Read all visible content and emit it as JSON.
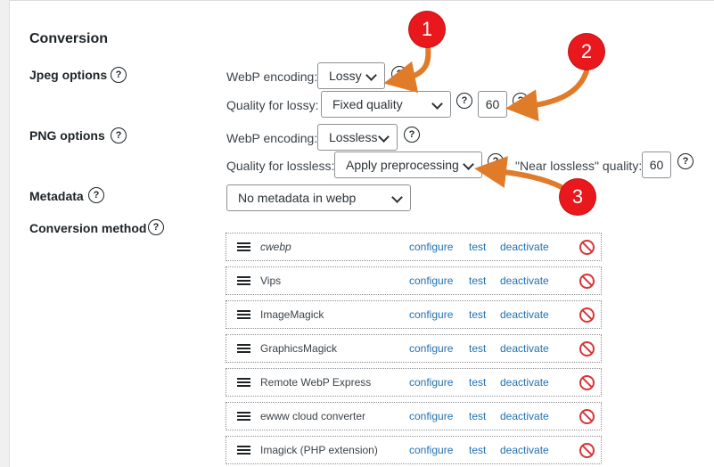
{
  "section_title": "Conversion",
  "jpeg": {
    "label": "Jpeg options",
    "encoding_label": "WebP encoding:",
    "encoding_value": "Lossy",
    "quality_label": "Quality for lossy:",
    "quality_value": "Fixed quality",
    "quality_number": "60"
  },
  "png": {
    "label": "PNG options",
    "encoding_label": "WebP encoding:",
    "encoding_value": "Lossless",
    "quality_label": "Quality for lossless:",
    "quality_value": "Apply preprocessing",
    "near_lossless_label": "\"Near lossless\" quality:",
    "near_lossless_value": "60"
  },
  "metadata": {
    "label": "Metadata",
    "value": "No metadata in webp"
  },
  "conversion_method": {
    "label": "Conversion method",
    "configure_label": "configure",
    "test_label": "test",
    "deactivate_label": "deactivate",
    "converters": [
      {
        "name": "cwebp"
      },
      {
        "name": "Vips"
      },
      {
        "name": "ImageMagick"
      },
      {
        "name": "GraphicsMagick"
      },
      {
        "name": "Remote WebP Express"
      },
      {
        "name": "ewww cloud converter"
      },
      {
        "name": "Imagick (PHP extension)"
      }
    ]
  },
  "help_glyph": "?",
  "annotations": [
    "1",
    "2",
    "3"
  ],
  "colors": {
    "marker": "#e8181d",
    "arrow": "#e07b2a",
    "link": "#2271b1",
    "ban": "#d63638"
  }
}
